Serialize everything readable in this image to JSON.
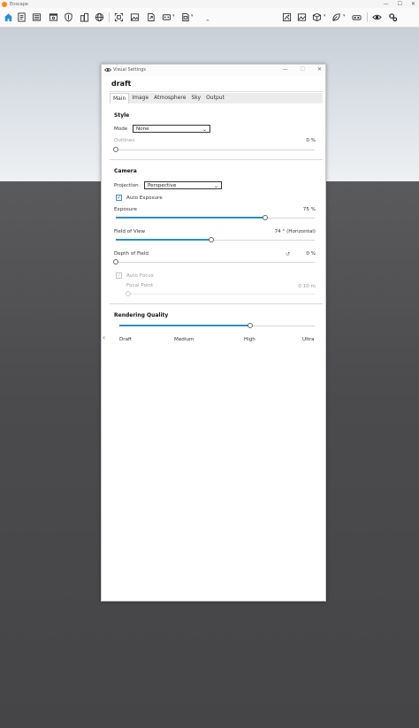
{
  "app": {
    "title": "Enscape"
  },
  "window_controls": {
    "minimize": "—",
    "maximize": "☐",
    "close": "✕"
  },
  "toolbar": {
    "left_icons": [
      "home-icon",
      "document-icon",
      "list-icon",
      "window-icon",
      "shield-icon",
      "buildings-icon",
      "globe-icon",
      "screenshot-icon",
      "image-icon",
      "export-icon",
      "render-icon",
      "panorama-icon",
      "video-icon"
    ],
    "right_icons": [
      "asset-library-icon",
      "material-icon",
      "cube-icon",
      "leaf-icon",
      "vr-headset-icon",
      "visual-settings-icon",
      "settings-icon"
    ]
  },
  "panel": {
    "title": "Visual Settings",
    "preset_name": "draft",
    "tabs": [
      "Main",
      "Image",
      "Atmosphere",
      "Sky",
      "Output"
    ],
    "active_tab": "Main",
    "style": {
      "section_title": "Style",
      "mode_label": "Mode",
      "mode_value": "None",
      "outlines_label": "Outlines",
      "outlines_value": "0 %",
      "outlines_fraction": 0
    },
    "camera": {
      "section_title": "Camera",
      "projection_label": "Projection",
      "projection_value": "Perspective",
      "auto_exposure_label": "Auto Exposure",
      "auto_exposure_checked": true,
      "exposure_label": "Exposure",
      "exposure_value": "75 %",
      "exposure_fraction": 0.75,
      "fov_label": "Field of View",
      "fov_value": "74 ° (Horizontal)",
      "fov_fraction": 0.48,
      "dof_label": "Depth of Field",
      "dof_value": "0 %",
      "dof_fraction": 0,
      "auto_focus_label": "Auto Focus",
      "auto_focus_checked": true,
      "focal_point_label": "Focal Point",
      "focal_point_value": "0.10 m",
      "focal_point_fraction": 0
    },
    "quality": {
      "section_title": "Rendering Quality",
      "levels": [
        "Draft",
        "Medium",
        "High",
        "Ultra"
      ],
      "fraction": 0.67
    }
  },
  "colors": {
    "accent": "#2a8fd1",
    "brand": "#f58a1f"
  }
}
